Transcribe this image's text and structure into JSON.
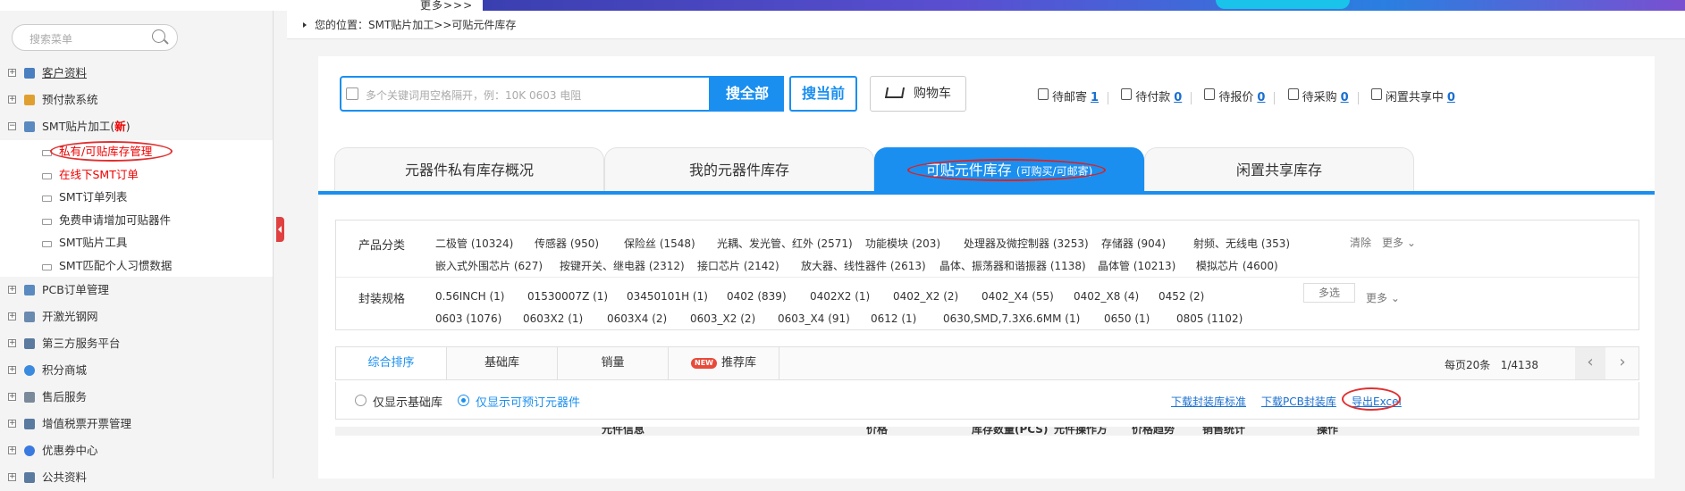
{
  "top": {
    "more_label": "更多>>>"
  },
  "sidebar": {
    "search_placeholder": "搜索菜单",
    "items": [
      {
        "label": "客户资料",
        "expanded": false,
        "underlined": true
      },
      {
        "label": "预付款系统",
        "expanded": false
      },
      {
        "label": "SMT贴片加工(",
        "badge": "新",
        "expanded": true
      },
      {
        "label": "PCB订单管理",
        "expanded": false
      },
      {
        "label": "开激光钢网",
        "expanded": false
      },
      {
        "label": "第三方服务平台",
        "expanded": false
      },
      {
        "label": "积分商城",
        "expanded": false
      },
      {
        "label": "售后服务",
        "expanded": false
      },
      {
        "label": "增值税票开票管理",
        "expanded": false
      },
      {
        "label": "优惠券中心",
        "expanded": false
      },
      {
        "label": "公共资料",
        "expanded": false
      }
    ],
    "smt_subitems": [
      {
        "label": "私有/可贴库存管理",
        "highlight": true
      },
      {
        "label": "在线下SMT订单",
        "highlight": true
      },
      {
        "label": "SMT订单列表"
      },
      {
        "label": "免费申请增加可贴器件"
      },
      {
        "label": "SMT贴片工具"
      },
      {
        "label": "SMT匹配个人习惯数据"
      }
    ]
  },
  "breadcrumb": {
    "text": "您的位置：SMT贴片加工>>可贴元件库存"
  },
  "search": {
    "placeholder": "多个关键词用空格隔开，例：10K 0603 电阻",
    "search_all": "搜全部",
    "search_current": "搜当前",
    "cart": "购物车"
  },
  "stats": [
    {
      "label": "待邮寄",
      "value": "1"
    },
    {
      "label": "待付款",
      "value": "0"
    },
    {
      "label": "待报价",
      "value": "0"
    },
    {
      "label": "待采购",
      "value": "0"
    },
    {
      "label": "闲置共享中",
      "value": "0"
    }
  ],
  "tabs": [
    {
      "label": "元器件私有库存概况",
      "sub": ""
    },
    {
      "label": "我的元器件库存",
      "sub": ""
    },
    {
      "label": "可贴元件库存",
      "sub": "(可购买/可邮寄)",
      "active": true
    },
    {
      "label": "闲置共享库存",
      "sub": ""
    }
  ],
  "filters": {
    "category_label": "产品分类",
    "categories_row1": [
      "二极管 (10324)",
      "传感器 (950)",
      "保险丝 (1548)",
      "光耦、发光管、红外 (2571)",
      "功能模块 (203)",
      "处理器及微控制器 (3253)",
      "存储器 (904)",
      "射频、无线电 (353)"
    ],
    "categories_row2": [
      "嵌入式外围芯片 (627)",
      "按键开关、继电器 (2312)",
      "接口芯片 (2142)",
      "放大器、线性器件 (2613)",
      "晶体、振荡器和谐振器 (1138)",
      "晶体管 (10213)",
      "模拟芯片 (4600)"
    ],
    "clear_label": "清除",
    "more_label": "更多",
    "package_label": "封装规格",
    "packages_row1": [
      "0.56INCH (1)",
      "01530007Z (1)",
      "03450101H (1)",
      "0402 (839)",
      "0402X2 (1)",
      "0402_X2 (2)",
      "0402_X4 (55)",
      "0402_X8 (4)",
      "0452 (2)"
    ],
    "packages_row2": [
      "0603 (1076)",
      "0603X2 (1)",
      "0603X4 (2)",
      "0603_X2 (2)",
      "0603_X4 (91)",
      "0612 (1)",
      "0630,SMD,7.3X6.6MM (1)",
      "0650 (1)",
      "0805 (1102)"
    ],
    "multi_label": "多选"
  },
  "sorts": {
    "items": [
      "综合排序",
      "基础库",
      "销量",
      "推荐库"
    ],
    "new_badge": "NEW",
    "per_page": "每页20条",
    "page": "1/4138",
    "prev": "‹",
    "next": "›"
  },
  "options": {
    "radio1": "仅显示基础库",
    "radio2": "仅显示可预订元器件",
    "link1": "下载封装库标准",
    "link2": "下载PCB封装库",
    "link3": "导出Excel"
  },
  "table_headers": [
    "元件信息",
    "价格",
    "库存数量(PCS)",
    "元件操作方",
    "价格趋势",
    "销售统计",
    "操作"
  ],
  "colors": {
    "accent": "#1a8ff0",
    "highlight_red": "#e00000"
  }
}
